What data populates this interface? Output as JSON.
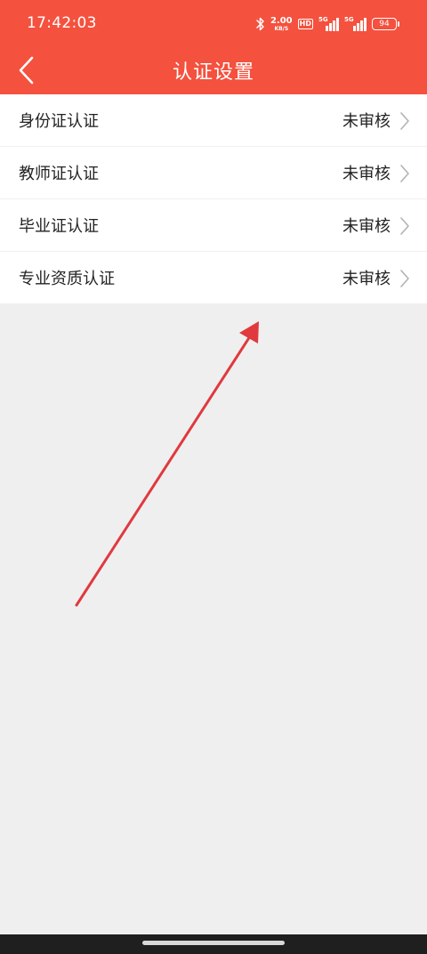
{
  "status_bar": {
    "time": "17:42:03",
    "net_speed_value": "2.00",
    "net_speed_unit": "KB/S",
    "hd_badge": "HD",
    "signal1_tag": "5G",
    "signal2_tag": "5G",
    "battery": "94"
  },
  "header": {
    "title": "认证设置"
  },
  "verifications": [
    {
      "label": "身份证认证",
      "status": "未审核"
    },
    {
      "label": "教师证认证",
      "status": "未审核"
    },
    {
      "label": "毕业证认证",
      "status": "未审核"
    },
    {
      "label": "专业资质认证",
      "status": "未审核"
    }
  ],
  "colors": {
    "header_bg": "#f4513e",
    "page_bg": "#efefef",
    "annotation_arrow": "#e0393e"
  },
  "icons": {
    "back": "chevron-left-icon",
    "row_chevron": "chevron-right-icon",
    "bluetooth": "bluetooth-icon",
    "battery": "battery-icon"
  }
}
